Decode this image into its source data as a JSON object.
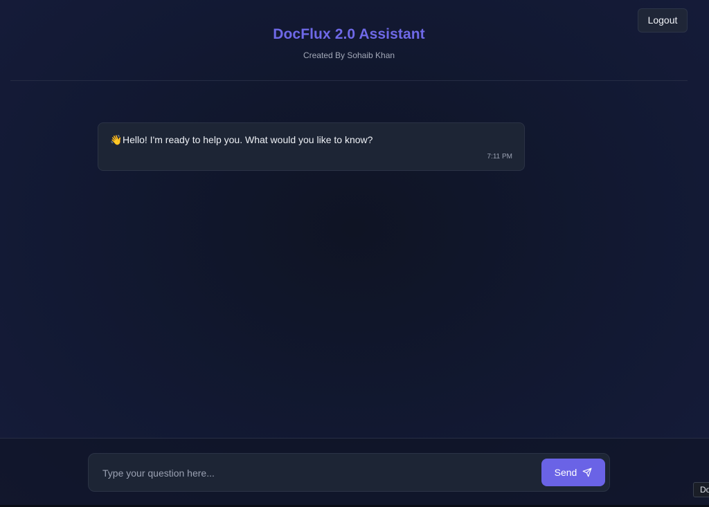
{
  "header": {
    "title": "DocFlux 2.0 Assistant",
    "subtitle": "Created By Sohaib Khan",
    "logout_label": "Logout"
  },
  "messages": [
    {
      "icon": "waving-hand-icon",
      "emoji": "👋",
      "text": "Hello! I'm ready to help you. What would you like to know?",
      "time": "7:11 PM"
    }
  ],
  "composer": {
    "placeholder": "Type your question here...",
    "value": "",
    "send_label": "Send",
    "send_icon": "paper-plane-icon"
  },
  "corner_badge": {
    "text": "Do"
  },
  "colors": {
    "accent": "#6a63e6",
    "title": "#6f69e8",
    "background": "#121933",
    "bubble": "#1d2535"
  }
}
